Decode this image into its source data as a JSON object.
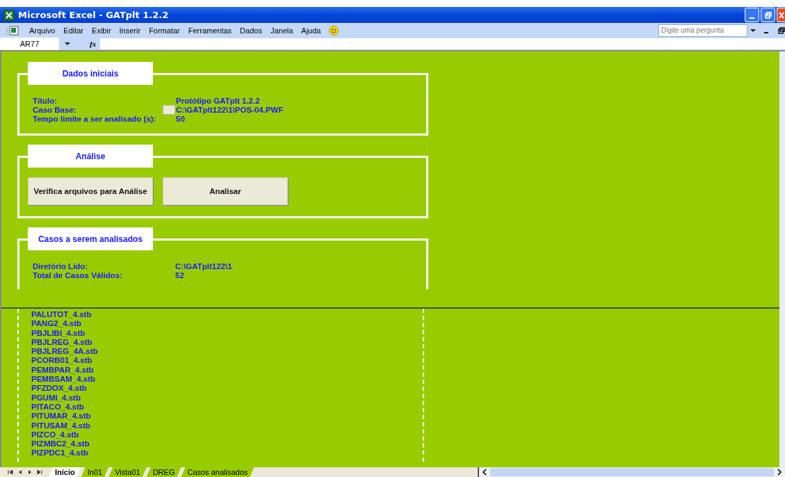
{
  "window": {
    "title": "Microsoft Excel - GATplt 1.2.2"
  },
  "menu": [
    "Arquivo",
    "Editar",
    "Exibir",
    "Inserir",
    "Formatar",
    "Ferramentas",
    "Dados",
    "Janela",
    "Ajuda"
  ],
  "help_box": {
    "placeholder": "Digite uma pergunta"
  },
  "formula_bar": {
    "name_box": "AR77",
    "fx": "fx"
  },
  "dados_iniciais": {
    "heading": "Dados iniciais",
    "fields": [
      {
        "label": "Título:",
        "value": "Protótipo GATplt 1.2.2",
        "has_button": false
      },
      {
        "label": "Caso Base:",
        "value": "C:\\GATplt122\\1\\POS-04.PWF",
        "has_button": true
      },
      {
        "label": "Tempo limite a ser analisado (s):",
        "value": "50",
        "has_button": false
      }
    ]
  },
  "analise": {
    "heading": "Análise",
    "buttons": [
      "Verifica arquivos para Análise",
      "Analisar"
    ]
  },
  "casos": {
    "heading": "Casos a serem analisados",
    "fields": [
      {
        "label": "Diretório Lido:",
        "value": "C:\\GATplt122\\1"
      },
      {
        "label": "Total de Casos Válidos:",
        "value": "52"
      }
    ],
    "files": [
      "PALUTOT_4.stb",
      "PANG2_4.stb",
      "PBJLIBI_4.stb",
      "PBJLREG_4.stb",
      "PBJLREG_4A.stb",
      "PCORB01_4.stb",
      "PEMBPAR_4.stb",
      "PEMBSAM_4.stb",
      "PFZDOX_4.stb",
      "PGUMI_4.stb",
      "PITACO_4.stb",
      "PITUMAR_4.stb",
      "PITUSAM_4.stb",
      "PIZCO_4.stb",
      "PIZMBC2_4.stb",
      "PIZPDC1_4.stb"
    ]
  },
  "sheet_tabs": [
    {
      "label": "Início",
      "selected": true
    },
    {
      "label": "In01",
      "selected": false
    },
    {
      "label": "Vista01",
      "selected": false
    },
    {
      "label": "DREG",
      "selected": false
    },
    {
      "label": "Casos analisados",
      "selected": false
    }
  ]
}
